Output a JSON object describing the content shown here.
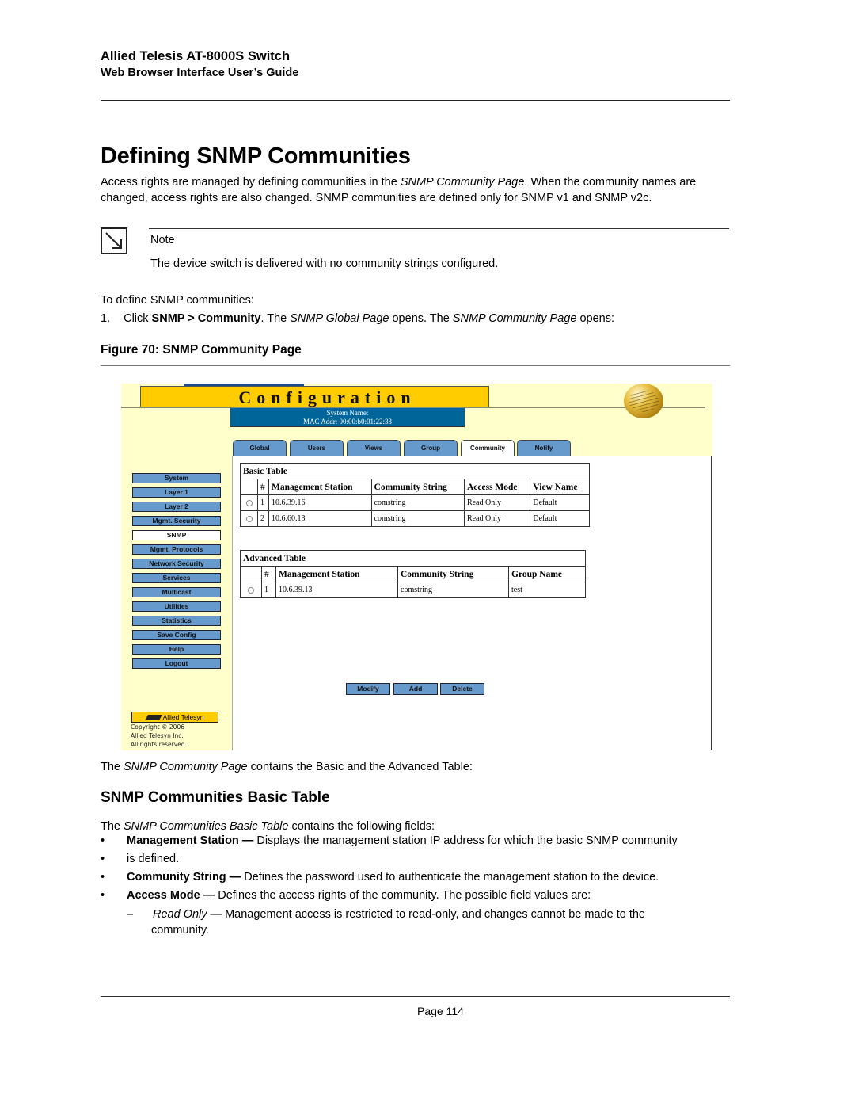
{
  "header": {
    "title": "Allied Telesis AT-8000S Switch",
    "subtitle": "Web Browser Interface User’s Guide"
  },
  "page_title": "Defining SNMP Communities",
  "intro": {
    "part1": "Access rights are managed by defining communities in the ",
    "italic1": "SNMP Community Page",
    "part2": ". When the community names are changed, access rights are also changed. SNMP communities are defined only for SNMP v1 and SNMP v2c."
  },
  "note": {
    "icon": "note-arrow-icon",
    "label": "Note",
    "text": "The device switch is delivered with no community strings configured."
  },
  "steps_intro": "To define SNMP communities:",
  "step1": {
    "num": "1.",
    "t1": "Click ",
    "b1": "SNMP > Community",
    "t2": ". The ",
    "i1": "SNMP Global Page",
    "t3": " opens. The ",
    "i2": "SNMP Community Page",
    "t4": " opens:"
  },
  "figure_caption": "Figure 70:  SNMP Community Page",
  "screenshot": {
    "banner": "Configuration",
    "system_name_label": "System Name:",
    "mac_label": "MAC Addr:  00:00:b0:01:22:33",
    "tabs": [
      {
        "label": "Global",
        "active": false
      },
      {
        "label": "Users",
        "active": false
      },
      {
        "label": "Views",
        "active": false
      },
      {
        "label": "Group",
        "active": false
      },
      {
        "label": "Community",
        "active": true
      },
      {
        "label": "Notify",
        "active": false
      }
    ],
    "sidebar": [
      {
        "label": "System",
        "active": false
      },
      {
        "label": "Layer 1",
        "active": false
      },
      {
        "label": "Layer 2",
        "active": false
      },
      {
        "label": "Mgmt. Security",
        "active": false
      },
      {
        "label": "SNMP",
        "active": true
      },
      {
        "label": "Mgmt. Protocols",
        "active": false
      },
      {
        "label": "Network Security",
        "active": false
      },
      {
        "label": "Services",
        "active": false
      },
      {
        "label": "Multicast",
        "active": false
      },
      {
        "label": "Utilities",
        "active": false
      },
      {
        "label": "Statistics",
        "active": false
      },
      {
        "label": "Save Config",
        "active": false
      },
      {
        "label": "Help",
        "active": false
      },
      {
        "label": "Logout",
        "active": false
      }
    ],
    "logo_text": "Allied Telesyn",
    "copyright_lines": [
      "Copyright © 2006",
      "Allied Telesyn Inc.",
      "All rights reserved."
    ],
    "basic_table": {
      "caption": "Basic Table",
      "headers": [
        "",
        "#",
        "Management Station",
        "Community String",
        "Access Mode",
        "View Name"
      ],
      "rows": [
        [
          "1",
          "10.6.39.16",
          "comstring",
          "Read Only",
          "Default"
        ],
        [
          "2",
          "10.6.60.13",
          "comstring",
          "Read Only",
          "Default"
        ]
      ]
    },
    "advanced_table": {
      "caption": "Advanced Table",
      "headers": [
        "",
        "#",
        "Management Station",
        "Community String",
        "Group Name"
      ],
      "rows": [
        [
          "1",
          "10.6.39.13",
          "comstring",
          "test"
        ]
      ]
    },
    "buttons": {
      "modify": "Modify",
      "add": "Add",
      "delete": "Delete"
    },
    "colors": {
      "banner": "#ffcc00",
      "sysbox": "#006699",
      "tab": "#6699cc",
      "background": "#ffffcc"
    }
  },
  "after_figure": {
    "t1": "The ",
    "i1": "SNMP Community Page",
    "t2": " contains the Basic and the Advanced Table:"
  },
  "section_heading": "SNMP Communities Basic Table",
  "section_intro": {
    "t1": "The ",
    "i1": "SNMP Communities Basic Table",
    "t2": " contains the following fields:"
  },
  "bullets": [
    {
      "bold": "Management Station —",
      "text": " Displays the management station IP address for which the basic SNMP community"
    },
    {
      "bold": "",
      "text": "is defined."
    },
    {
      "bold": "Community String —",
      "text": " Defines the password used to authenticate the management station to the device."
    },
    {
      "bold": "Access Mode —",
      "text": " Defines the access rights of the community. The possible field values are:"
    }
  ],
  "sub_bullet": {
    "dash": "–",
    "italic": "Read Only",
    "text": " — Management access is restricted to read-only, and changes cannot be made to the community."
  },
  "footer": {
    "page": "Page 114"
  }
}
